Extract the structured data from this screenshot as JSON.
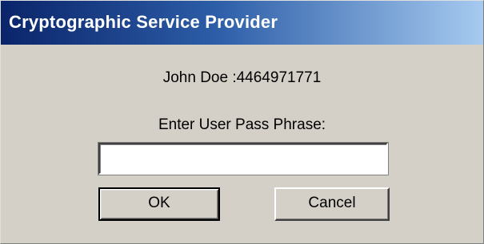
{
  "window": {
    "title": "Cryptographic Service Provider",
    "titlebar_color_start": "#0a246a",
    "titlebar_color_end": "#a6caf0",
    "background_color": "#d4d0c8"
  },
  "dialog": {
    "user_line": "John Doe :4464971771",
    "prompt": "Enter User Pass Phrase:",
    "pass_phrase": {
      "value": "",
      "placeholder": ""
    },
    "buttons": {
      "ok_label": "OK",
      "cancel_label": "Cancel"
    }
  }
}
